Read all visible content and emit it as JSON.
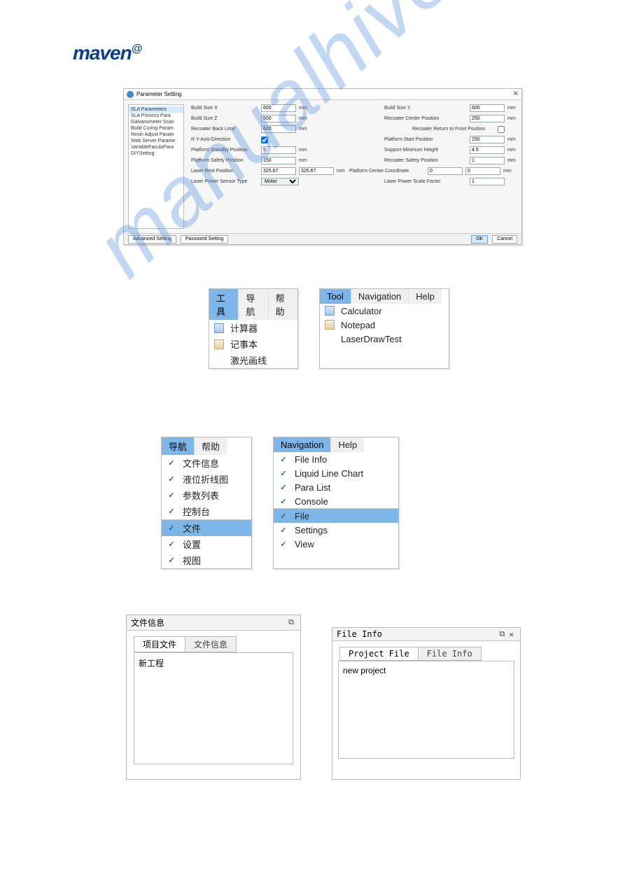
{
  "logo": "maven",
  "logo_suffix": "@",
  "watermark": "manualhive.com",
  "dialog": {
    "title": "Parameter Setting",
    "close": "✕",
    "sidebar": [
      "SLA Parameters",
      "SLA  Process Para",
      "Galvanometer Scan",
      "Build Curing Param",
      "Resin Adjust Param",
      "Web Server Parame",
      "VariableFaculaPara",
      "DIYSetting"
    ],
    "sidebar_sel": 0,
    "fields": {
      "build_size_x": {
        "label": "Build Size X",
        "value": "600",
        "unit": "mm"
      },
      "build_size_y": {
        "label": "Build Size Y",
        "value": "600",
        "unit": "mm"
      },
      "build_size_z": {
        "label": "Build Size Z",
        "value": "500",
        "unit": "mm"
      },
      "recoater_center": {
        "label": "Recoater Center Position",
        "value": "250",
        "unit": "mm"
      },
      "recoater_back": {
        "label": "Recoater Back Limit",
        "value": "600",
        "unit": "mm"
      },
      "recoater_return": {
        "label": "Recoater Return to Front Position",
        "checked": false
      },
      "r_yaxis": {
        "label": "R Y-Axis-Direction",
        "checked": true
      },
      "platform_start": {
        "label": "Platform Start Position",
        "value": "150",
        "unit": "mm"
      },
      "platform_standby": {
        "label": "Platform Standby Position",
        "value": "5",
        "unit": "mm"
      },
      "support_min": {
        "label": "Support Minimum Height",
        "value": "4.5",
        "unit": "mm"
      },
      "platform_safety": {
        "label": "Platform Safety Position",
        "value": "150",
        "unit": "mm"
      },
      "recoater_safety": {
        "label": "Recoater Safety Position",
        "value": "1",
        "unit": "mm"
      },
      "laser_rest": {
        "label": "Laser Rest Position",
        "v1": "325.67",
        "v2": "325.67",
        "unit": "mm"
      },
      "platform_center": {
        "label": "Platform Center Coordinate",
        "v1": "0",
        "v2": "0",
        "unit": "mm"
      },
      "laser_sensor_type": {
        "label": "Laser Power Sensor Type",
        "value": "Motor"
      },
      "laser_scale": {
        "label": "Laser Power Scale Factor",
        "value": "1"
      }
    },
    "footer": {
      "adv": "Advanced Setting",
      "pwd": "Password Setting",
      "ok": "OK",
      "cancel": "Cancel"
    }
  },
  "menus_tool": {
    "cn": {
      "bar": [
        "工具",
        "导航",
        "帮助"
      ],
      "items": [
        "计算器",
        "记事本",
        "激光画线"
      ]
    },
    "en": {
      "bar": [
        "Tool",
        "Navigation",
        "Help"
      ],
      "items": [
        "Calculator",
        "Notepad",
        "LaserDrawTest"
      ]
    }
  },
  "menus_nav": {
    "cn": {
      "bar": [
        "导航",
        "帮助"
      ],
      "groups": [
        [
          "文件信息",
          "液位折线图",
          "参数列表",
          "控制台"
        ],
        [
          "文件",
          "设置",
          "视图"
        ]
      ],
      "sel": "文件"
    },
    "en": {
      "bar": [
        "Navigation",
        "Help"
      ],
      "groups": [
        [
          "File Info",
          "Liquid Line Chart",
          "Para List",
          "Console"
        ],
        [
          "File",
          "Settings",
          "View"
        ]
      ],
      "sel": "File"
    }
  },
  "panels": {
    "cn": {
      "title": "文件信息",
      "tabs": [
        "项目文件",
        "文件信息"
      ],
      "content": "新工程",
      "dock": "⧉"
    },
    "en": {
      "title": "File Info",
      "tabs": [
        "Project File",
        "File Info"
      ],
      "content": "new project",
      "dock": "⧉",
      "close": "✕"
    }
  }
}
